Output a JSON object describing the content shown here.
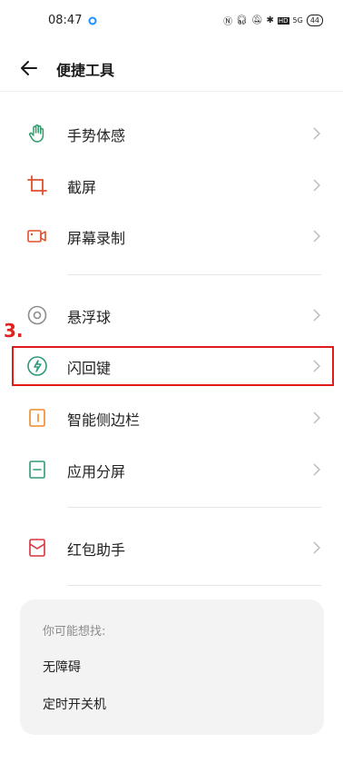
{
  "status_bar": {
    "time": "08:47",
    "icons": [
      "nfc-icon",
      "headset-icon",
      "mute-icon",
      "bluetooth-icon",
      "hd-icon",
      "signal-icon"
    ],
    "hd_label": "HD",
    "signal_label": "5G",
    "battery": "44"
  },
  "header": {
    "title": "便捷工具"
  },
  "groups": [
    [
      {
        "label": "手势体感",
        "icon": "hand-gesture-icon",
        "color": "#2e9a6a"
      },
      {
        "label": "截屏",
        "icon": "crop-icon",
        "color": "#e0502c"
      },
      {
        "label": "屏幕录制",
        "icon": "video-record-icon",
        "color": "#e0502c"
      }
    ],
    [
      {
        "label": "悬浮球",
        "icon": "floating-ball-icon",
        "color": "#8c8c8c"
      },
      {
        "label": "闪回键",
        "icon": "flashback-icon",
        "color": "#2e9a7a"
      },
      {
        "label": "智能侧边栏",
        "icon": "sidebar-icon",
        "color": "#ef8a2a"
      },
      {
        "label": "应用分屏",
        "icon": "split-screen-icon",
        "color": "#2e9a7a"
      }
    ],
    [
      {
        "label": "红包助手",
        "icon": "red-envelope-icon",
        "color": "#d9333a"
      }
    ]
  ],
  "annotation": {
    "label": "3."
  },
  "suggestions": {
    "title": "你可能想找:",
    "items": [
      "无障碍",
      "定时开关机"
    ]
  },
  "colors": {
    "accent_red": "#e01b1b",
    "chevron": "#bdbdbd"
  }
}
